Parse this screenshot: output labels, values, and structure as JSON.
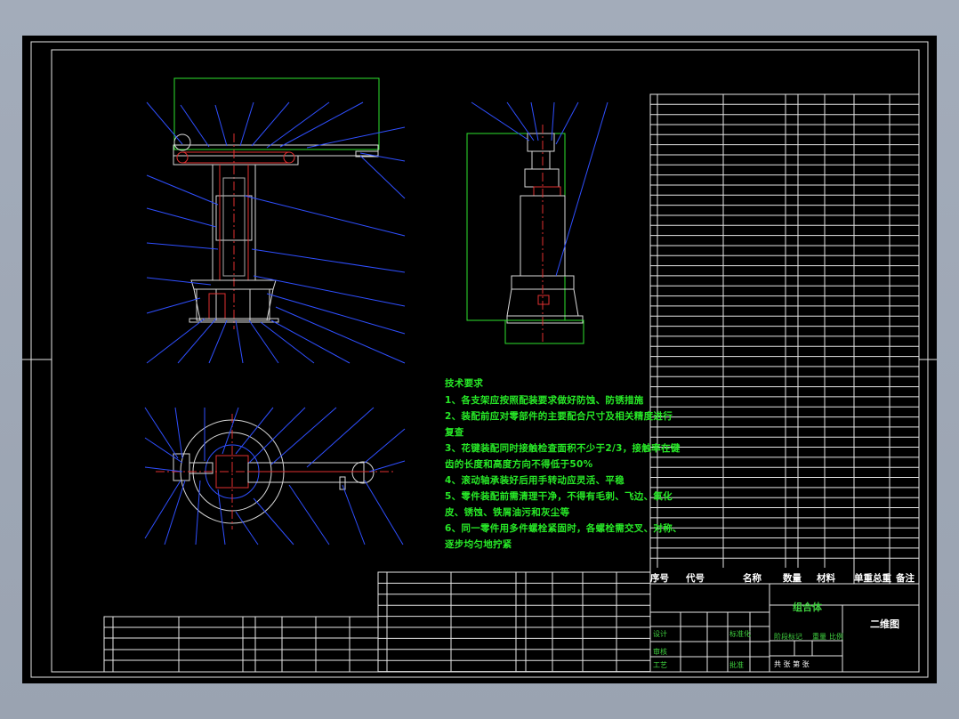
{
  "technical_requirements": {
    "heading": "技术要求",
    "lines": [
      "1、各支架应按照配装要求做好防蚀、防锈措施",
      "2、装配前应对零部件的主要配合尺寸及相关精度进行",
      "复查",
      "3、花键装配同时接触检查面积不少于2/3，接触率在键",
      "齿的长度和高度方向不得低于50%",
      "4、滚动轴承装好后用手转动应灵活、平稳",
      "5、零件装配前需清理干净，不得有毛刺、飞边、氧化",
      "皮、锈蚀、铁屑油污和灰尘等",
      "6、同一零件用多件螺栓紧固时，各螺栓需交叉、对称、",
      "逐步均匀地拧紧"
    ]
  },
  "parts_header": {
    "index": "序号",
    "code": "代号",
    "name": "名称",
    "qty": "数量",
    "material": "材料",
    "weight": "单重总重",
    "note": "备注"
  },
  "title_block": {
    "assembly_name": "组合体",
    "drawing_title": "二维图",
    "design_label": "设计",
    "standardization_label": "标准化",
    "review_label": "审核",
    "process_label": "工艺",
    "approve_label": "批准",
    "stage_mark_label": "阶段标记",
    "weight_label": "重量",
    "scale_label": "比例",
    "sheet_total": "共 张 第 张"
  }
}
